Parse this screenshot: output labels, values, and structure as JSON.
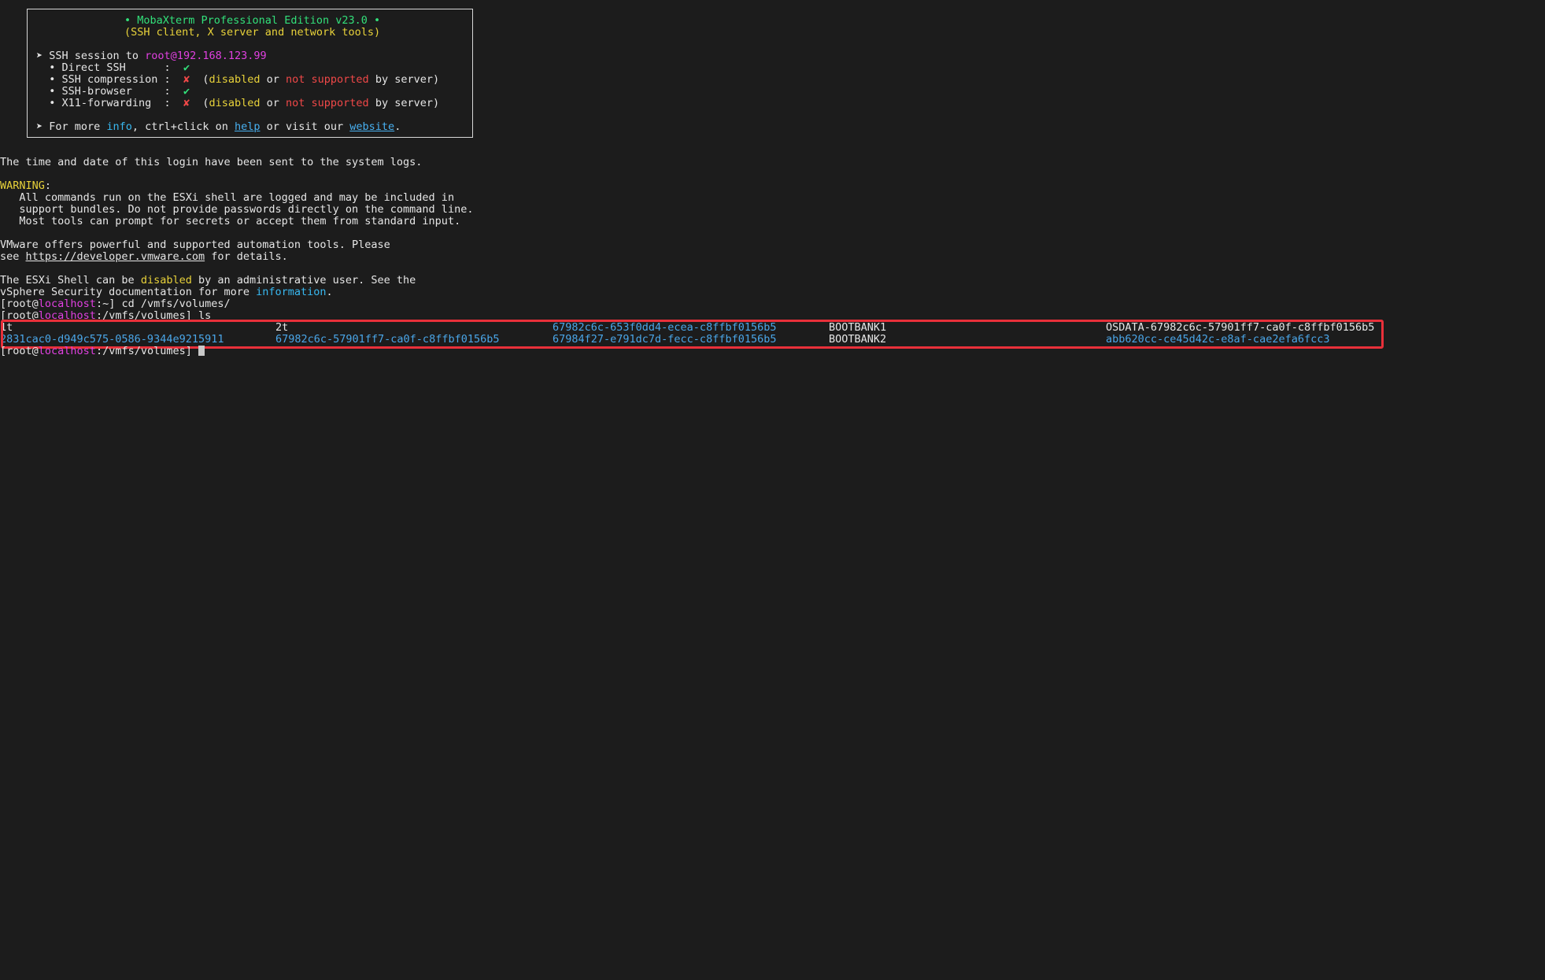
{
  "banner": {
    "title": "• MobaXterm Professional Edition v23.0 •",
    "subtitle": "(SSH client, X server and network tools)",
    "ssh_line_prefix": "➤ SSH session to ",
    "ssh_target": "root@192.168.123.99",
    "items": [
      {
        "label": "  • Direct SSH      :  ",
        "mark": "✔"
      },
      {
        "label": "  • SSH compression :  ",
        "mark": "✘",
        "note_prefix": "  (",
        "disabled": "disabled",
        "or": " or ",
        "not_supported": "not supported",
        "suffix": " by server)"
      },
      {
        "label": "  • SSH-browser     :  ",
        "mark": "✔"
      },
      {
        "label": "  • X11-forwarding  :  ",
        "mark": "✘",
        "note_prefix": "  (",
        "disabled": "disabled",
        "or": " or ",
        "not_supported": "not supported",
        "suffix": " by server)"
      }
    ],
    "more_prefix": "➤ For more ",
    "more_info": "info",
    "more_mid": ", ctrl+click on ",
    "more_help": "help",
    "more_mid2": " or visit our ",
    "more_website": "website",
    "more_end": "."
  },
  "motd": {
    "logs_line": "The time and date of this login have been sent to the system logs.",
    "warning_label": "WARNING",
    "warning_colon": ":",
    "warning_lines": [
      "   All commands run on the ESXi shell are logged and may be included in",
      "   support bundles. Do not provide passwords directly on the command line.",
      "   Most tools can prompt for secrets or accept them from standard input."
    ],
    "vmware_line1": "VMware offers powerful and supported automation tools. Please",
    "vmware_see": "see ",
    "vmware_url": "https://developer.vmware.com",
    "vmware_end": " for details.",
    "esxi_prefix": "The ESXi Shell can be ",
    "esxi_disabled": "disabled",
    "esxi_suffix": " by an administrative user. See the",
    "vsphere_prefix": "vSphere Security documentation for more ",
    "vsphere_info": "information",
    "vsphere_end": "."
  },
  "prompts": [
    {
      "open": "[root@",
      "host": "localhost",
      "path": ":~] ",
      "cmd": "cd /vmfs/volumes/"
    },
    {
      "open": "[root@",
      "host": "localhost",
      "path": ":/vmfs/volumes] ",
      "cmd": "ls"
    },
    {
      "open": "[root@",
      "host": "localhost",
      "path": ":/vmfs/volumes] ",
      "cmd": ""
    }
  ],
  "ls_output": {
    "row1": [
      "1t",
      "2t",
      "67982c6c-653f0dd4-ecea-c8ffbf0156b5",
      "BOOTBANK1",
      "OSDATA-67982c6c-57901ff7-ca0f-c8ffbf0156b5"
    ],
    "row2": [
      "2831cac0-d949c575-0586-9344e9215911",
      "67982c6c-57901ff7-ca0f-c8ffbf0156b5",
      "67984f27-e791dc7d-fecc-c8ffbf0156b5",
      "BOOTBANK2",
      "abb620cc-ce45d42c-e8af-cae2efa6fcc3"
    ]
  },
  "colors": {
    "background": "#1c1c1c",
    "highlight_border": "#e8303a",
    "link": "#48b0f0",
    "prompt_host": "#e040e0"
  }
}
